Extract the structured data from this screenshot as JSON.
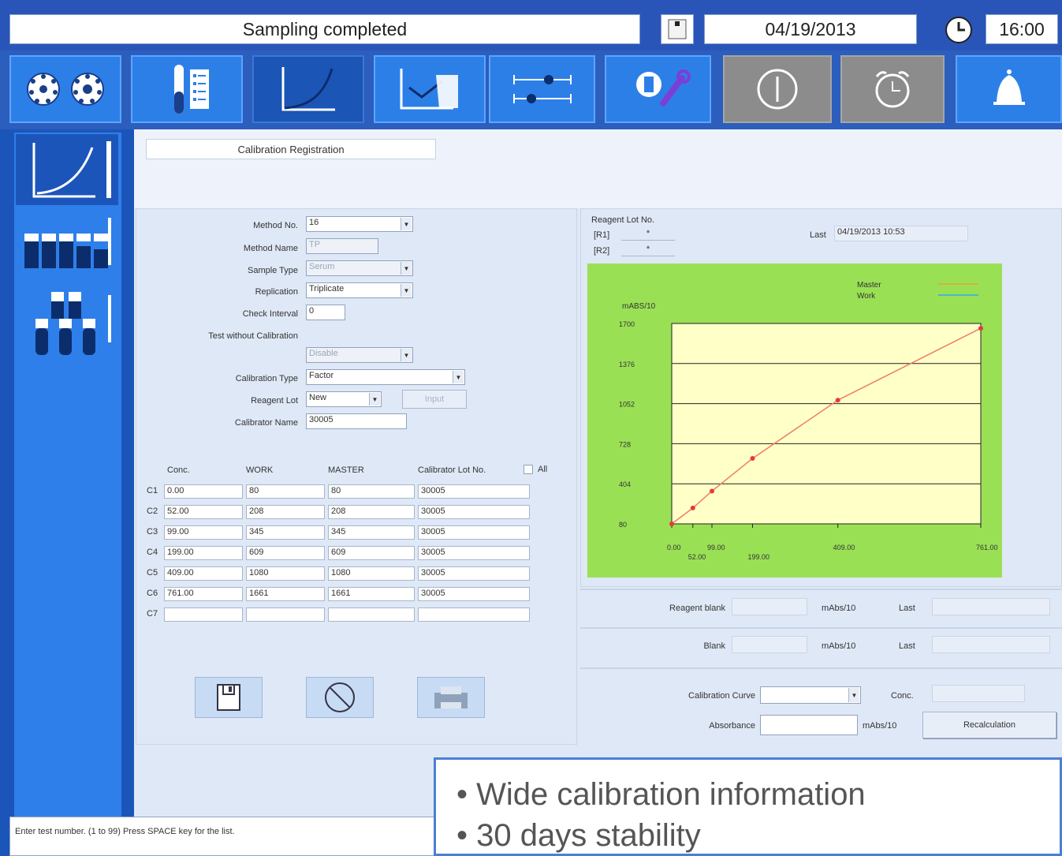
{
  "status": {
    "message": "Sampling completed",
    "date": "04/19/2013",
    "time": "16:00"
  },
  "icons": {
    "toolbar": [
      "carousel-icon",
      "sample-rack-icon",
      "calibration-curve-icon",
      "qc-chart-icon",
      "parameters-icon",
      "maintenance-icon",
      "power-icon",
      "alarm-clock-icon",
      "bell-icon"
    ],
    "sidebar": [
      "calibration-curve-icon",
      "reagent-tubes-icon",
      "sample-tubes-icon"
    ]
  },
  "colors": {
    "toolbar_active": "#1b55b6",
    "chart_bg": "#ffffc8",
    "chart_frame": "#99e055",
    "curve": "#ee7f6a",
    "point": "#e8393b"
  },
  "panel": {
    "title": "Calibration Registration"
  },
  "form": {
    "method_no_label": "Method No.",
    "method_no": "16",
    "method_name_label": "Method Name",
    "method_name": "TP",
    "sample_type_label": "Sample Type",
    "sample_type": "Serum",
    "replication_label": "Replication",
    "replication": "Triplicate",
    "check_interval_label": "Check Interval",
    "check_interval": "0",
    "test_without_cal_label": "Test without Calibration",
    "test_without_cal": "Disable",
    "calibration_type_label": "Calibration Type",
    "calibration_type": "Factor",
    "reagent_lot_label": "Reagent Lot",
    "reagent_lot": "New",
    "reagent_lot_btn": "Input",
    "calibrator_name_label": "Calibrator Name",
    "calibrator_name": "30005"
  },
  "table": {
    "headers": [
      "Conc.",
      "WORK",
      "MASTER",
      "Calibrator Lot No."
    ],
    "all_label": "All",
    "rows": [
      {
        "id": "C1",
        "conc": "0.00",
        "work": "80",
        "master": "80",
        "lot": "30005"
      },
      {
        "id": "C2",
        "conc": "52.00",
        "work": "208",
        "master": "208",
        "lot": "30005"
      },
      {
        "id": "C3",
        "conc": "99.00",
        "work": "345",
        "master": "345",
        "lot": "30005"
      },
      {
        "id": "C4",
        "conc": "199.00",
        "work": "609",
        "master": "609",
        "lot": "30005"
      },
      {
        "id": "C5",
        "conc": "409.00",
        "work": "1080",
        "master": "1080",
        "lot": "30005"
      },
      {
        "id": "C6",
        "conc": "761.00",
        "work": "1661",
        "master": "1661",
        "lot": "30005"
      },
      {
        "id": "C7",
        "conc": "",
        "work": "",
        "master": "",
        "lot": ""
      }
    ]
  },
  "reagent": {
    "lot_label": "Reagent Lot No.",
    "r1_label": "[R1]",
    "r1": "*",
    "r2_label": "[R2]",
    "r2": "*",
    "last_label": "Last",
    "last": "04/19/2013 10:53"
  },
  "chart_data": {
    "type": "line",
    "ylabel": "mABS/10",
    "yticks": [
      "1700",
      "1376",
      "1052",
      "728",
      "404",
      "80"
    ],
    "ylim": [
      80,
      1700
    ],
    "xlim": [
      0,
      761
    ],
    "xticks_row1": [
      "0.00",
      "99.00",
      "409.00",
      "761.00"
    ],
    "xticks_row2": [
      "52.00",
      "199.00"
    ],
    "legend": [
      {
        "name": "Master",
        "color": "#e8a52a"
      },
      {
        "name": "Work",
        "color": "#3aa6e8"
      }
    ],
    "series": [
      {
        "name": "Work",
        "x": [
          0,
          52,
          99,
          199,
          409,
          761
        ],
        "y": [
          80,
          208,
          345,
          609,
          1080,
          1661
        ]
      }
    ]
  },
  "blank": {
    "reagent_blank_label": "Reagent blank",
    "blank_label": "Blank",
    "unit": "mAbs/10",
    "last_label": "Last"
  },
  "recalc": {
    "curve_label": "Calibration Curve",
    "conc_label": "Conc.",
    "absorbance_label": "Absorbance",
    "unit": "mAbs/10",
    "button": "Recalculation"
  },
  "footer": {
    "status": "Enter test number. (1 to 99) Press SPACE key for the list.",
    "bullets": [
      "Wide calibration information",
      "30 days stability"
    ]
  }
}
